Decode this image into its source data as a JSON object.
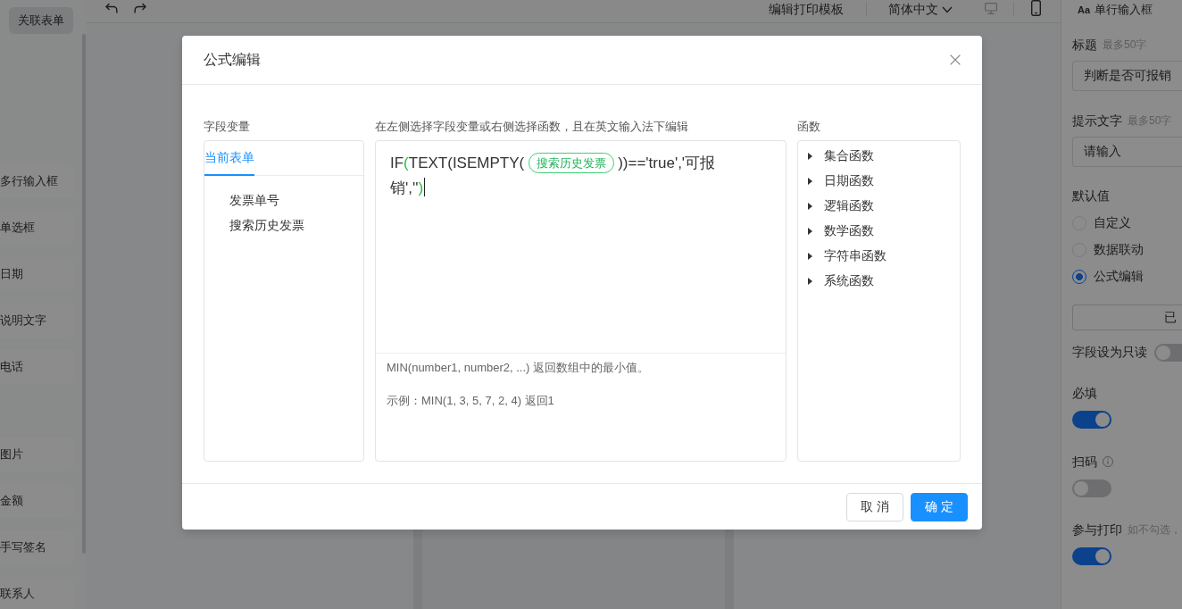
{
  "sidebar": {
    "top_item": {
      "label": "关联表单",
      "selected": true
    },
    "groups": [
      {
        "items": [
          {
            "label": "多行输入框",
            "selected": false
          },
          {
            "label": "单选框",
            "selected": false
          },
          {
            "label": "日期",
            "selected": false
          },
          {
            "label": "说明文字",
            "selected": false
          },
          {
            "label": "电话",
            "selected": false
          }
        ]
      },
      {
        "items": [
          {
            "label": "图片",
            "selected": false
          },
          {
            "label": "金额",
            "selected": false
          },
          {
            "label": "手写签名",
            "selected": false
          },
          {
            "label": "联系人",
            "selected": false
          }
        ]
      }
    ]
  },
  "toolbar": {
    "print_template": "编辑打印模板",
    "language": "简体中文",
    "view_modes": [
      {
        "kind": "desktop",
        "selected": false
      },
      {
        "kind": "mobile",
        "selected": true
      }
    ]
  },
  "properties_panel": {
    "type_icon": "Aa",
    "title": "单行输入框",
    "fields": [
      {
        "label": "标题",
        "hint": "最多50字",
        "value": "判断是否可报销"
      },
      {
        "label": "提示文字",
        "hint": "最多50字",
        "value": "请输入"
      }
    ],
    "default_value": {
      "label": "默认值",
      "options": [
        {
          "label": "自定义",
          "selected": false
        },
        {
          "label": "数据联动",
          "selected": false
        },
        {
          "label": "公式编辑",
          "selected": true
        }
      ],
      "button": "已"
    },
    "switches": [
      {
        "kind": "inline",
        "label": "字段设为只读",
        "on": false
      },
      {
        "kind": "stacked",
        "label": "必填",
        "on": true
      },
      {
        "kind": "stacked",
        "label": "扫码",
        "info": true,
        "on": false
      },
      {
        "kind": "stacked",
        "label": "参与打印",
        "hint": "如不勾选，",
        "on": true
      }
    ]
  },
  "dialog": {
    "title": "公式编辑",
    "variables": {
      "label": "字段变量",
      "tabs": [
        {
          "label": "当前表单",
          "selected": true
        }
      ],
      "items": [
        "发票单号",
        "搜索历史发票"
      ]
    },
    "editor": {
      "label": "在左侧选择字段变量或右侧选择函数，且在英文输入法下编辑",
      "formula": [
        {
          "kind": "text",
          "text": "IF"
        },
        {
          "kind": "bracket",
          "text": "("
        },
        {
          "kind": "text",
          "text": "TEXT(ISEMPTY("
        },
        {
          "kind": "field",
          "text": "搜索历史发票"
        },
        {
          "kind": "text",
          "text": "))=='true','可报销',''"
        },
        {
          "kind": "bracket",
          "text": ")"
        }
      ],
      "description": "MIN(number1, number2, ...) 返回数组中的最小值。",
      "example": "示例：MIN(1, 3, 5, 7, 2, 4) 返回1"
    },
    "functions": {
      "label": "函数",
      "groups": [
        {
          "label": "集合函数",
          "expanded": false
        },
        {
          "label": "日期函数",
          "expanded": false
        },
        {
          "label": "逻辑函数",
          "expanded": false
        },
        {
          "label": "数学函数",
          "expanded": false
        },
        {
          "label": "字符串函数",
          "expanded": false
        },
        {
          "label": "系统函数",
          "expanded": false
        }
      ]
    },
    "buttons": [
      {
        "kind": "default",
        "label": "取消"
      },
      {
        "kind": "primary",
        "label": "确定"
      }
    ]
  }
}
